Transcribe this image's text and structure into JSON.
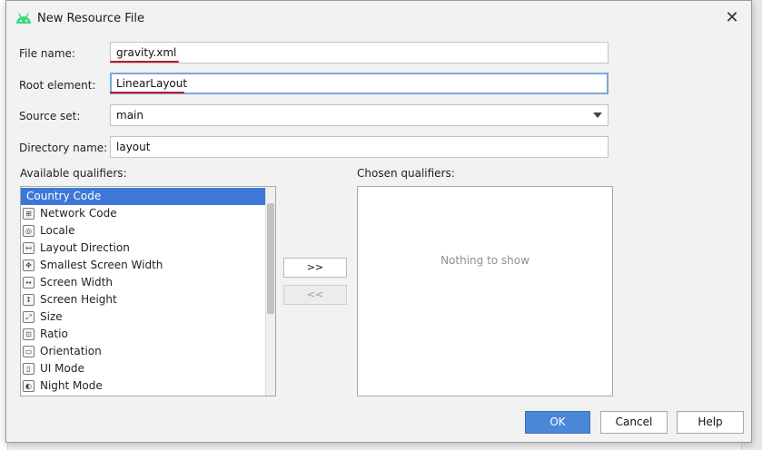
{
  "window": {
    "title": "New Resource File",
    "close_glyph": "✕"
  },
  "form": {
    "file_name_label": "File name:",
    "file_name_value": "gravity.xml",
    "root_element_label": "Root element:",
    "root_element_value": "LinearLayout",
    "source_set_label": "Source set:",
    "source_set_value": "main",
    "directory_label": "Directory name:",
    "directory_value": "layout"
  },
  "qualifiers": {
    "available_label": "Available qualifiers:",
    "chosen_label": "Chosen qualifiers:",
    "items": [
      {
        "label": "Country Code",
        "icon": "country-code-icon",
        "selected": true
      },
      {
        "label": "Network Code",
        "icon": "network-code-icon"
      },
      {
        "label": "Locale",
        "icon": "locale-icon"
      },
      {
        "label": "Layout Direction",
        "icon": "layout-direction-icon"
      },
      {
        "label": "Smallest Screen Width",
        "icon": "smallest-screen-width-icon"
      },
      {
        "label": "Screen Width",
        "icon": "screen-width-icon"
      },
      {
        "label": "Screen Height",
        "icon": "screen-height-icon"
      },
      {
        "label": "Size",
        "icon": "size-icon"
      },
      {
        "label": "Ratio",
        "icon": "ratio-icon"
      },
      {
        "label": "Orientation",
        "icon": "orientation-icon"
      },
      {
        "label": "UI Mode",
        "icon": "ui-mode-icon"
      },
      {
        "label": "Night Mode",
        "icon": "night-mode-icon"
      }
    ],
    "add_label": ">>",
    "remove_label": "<<",
    "empty_text": "Nothing to show"
  },
  "buttons": {
    "ok": "OK",
    "cancel": "Cancel",
    "help": "Help"
  },
  "colors": {
    "accent": "#3d78d8",
    "annotation_underline": "#c0162a",
    "android_green": "#3ddc84"
  }
}
